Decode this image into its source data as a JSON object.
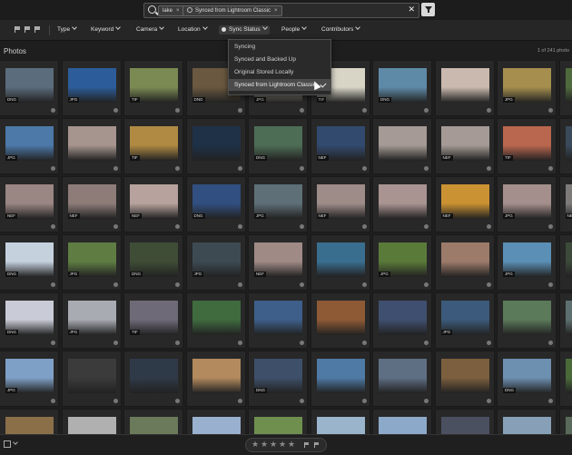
{
  "search": {
    "chips": [
      {
        "label": "lake"
      },
      {
        "label": "Synced from Lightroom Classic"
      }
    ],
    "clear_glyph": "✕",
    "chip_close_glyph": "×"
  },
  "filterbar": {
    "filters": [
      {
        "label": "Type"
      },
      {
        "label": "Keyword"
      },
      {
        "label": "Camera"
      },
      {
        "label": "Location"
      },
      {
        "label": "Sync Status"
      },
      {
        "label": "People"
      },
      {
        "label": "Contributors"
      }
    ]
  },
  "section": {
    "title": "Photos",
    "count": "1 of 241 photo"
  },
  "dropdown": {
    "items": [
      {
        "label": "Syncing"
      },
      {
        "label": "Synced and Backed Up"
      },
      {
        "label": "Original Stored Locally"
      },
      {
        "label": "Synced from Lightroom Classic",
        "selected": true
      }
    ]
  },
  "photos": [
    [
      "DNG",
      "JPG",
      "TIF",
      "DNG",
      "JPG",
      "TIF",
      "DNG",
      "",
      "JPG",
      ""
    ],
    [
      "JPG",
      "",
      "TIF",
      "",
      "DNG",
      "NEF",
      "",
      "NEF",
      "TIF",
      ""
    ],
    [
      "NEF",
      "NEF",
      "NEF",
      "DNG",
      "JPG",
      "NEF",
      "",
      "NEF",
      "JPG",
      "NEF"
    ],
    [
      "DNG",
      "JPG",
      "DNG",
      "JPG",
      "NEF",
      "",
      "JPG",
      "",
      "JPG",
      ""
    ],
    [
      "DNG",
      "JPG",
      "TIF",
      "",
      "",
      "",
      "",
      "JPG",
      "",
      ""
    ],
    [
      "JPG",
      "",
      "",
      "",
      "DNG",
      "",
      "",
      "",
      "DNG",
      ""
    ],
    [
      "",
      "",
      "",
      "",
      "",
      "",
      "",
      "",
      "",
      ""
    ]
  ],
  "colors": {
    "accent": "#d8d8d8",
    "background": "#1e1e1e",
    "cell": "#282828",
    "status_dot": "#777777",
    "thumbs": [
      [
        "#5b6c7d",
        "#2c5d9a",
        "#7b8a52",
        "#6a5840",
        "#bdb7a4",
        "#d8d5c7",
        "#5f8aa7",
        "#c9b9ae",
        "#a58e4e",
        "#4f6a3d"
      ],
      [
        "#4c79a8",
        "#a6958e",
        "#b08a43",
        "#1e3147",
        "#4e6d55",
        "#324a6e",
        "#a59a95",
        "#a59a95",
        "#b9674e",
        "#3b4a5a"
      ],
      [
        "#9a8683",
        "#8d7c78",
        "#b7a29d",
        "#314f80",
        "#5e6f77",
        "#9e8c89",
        "#a99491",
        "#cb9233",
        "#a48f8c",
        "#7d7a7a"
      ],
      [
        "#c5d1dd",
        "#5f7d43",
        "#3f4c36",
        "#3d4a52",
        "#9f8a86",
        "#3a6e8f",
        "#5a7a3a",
        "#9c7b6b",
        "#5b8fb5",
        "#3c4a3a"
      ],
      [
        "#c9ccd6",
        "#a8abb2",
        "#6f6a78",
        "#3f6b3f",
        "#3e5f8a",
        "#8e5a36",
        "#3f4f6f",
        "#3c5a7b",
        "#5b7a5a",
        "#5e6f6f"
      ],
      [
        "#7fa0c6",
        "#3b3b3b",
        "#2f3a48",
        "#b38a5e",
        "#3e4f6a",
        "#4e7aa5",
        "#5f6f83",
        "#7c5f3e",
        "#6d8fb0",
        "#4a6a3a"
      ],
      [
        "#8b6f49",
        "#b0b0b0",
        "#6a7a5a",
        "#9ab0cf",
        "#6f8f4f",
        "#9ab4cc",
        "#8da9c9",
        "#4a5060",
        "#87a0b7",
        "#5a6a5a"
      ]
    ]
  },
  "rating": {
    "stars": [
      "★",
      "★",
      "★",
      "★",
      "★"
    ]
  }
}
